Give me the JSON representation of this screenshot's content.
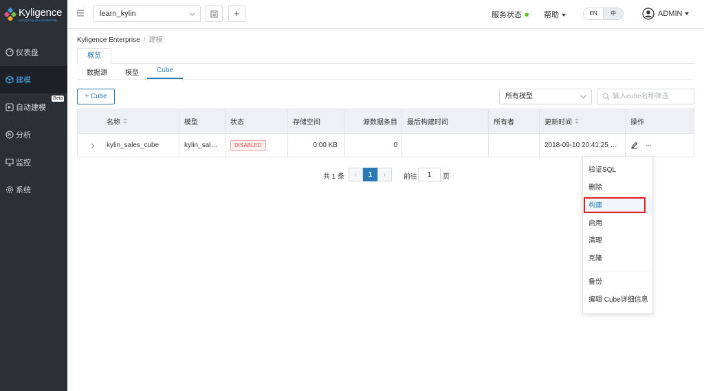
{
  "brand": {
    "name": "Kyligence",
    "tagline": "present big data productivity"
  },
  "sidebar": {
    "items": [
      {
        "label": "仪表盘",
        "icon": "dashboard-icon"
      },
      {
        "label": "建模",
        "icon": "cube-icon"
      },
      {
        "label": "自动建模",
        "icon": "auto-model-icon"
      },
      {
        "label": "分析",
        "icon": "analysis-icon"
      },
      {
        "label": "监控",
        "icon": "monitor-icon"
      },
      {
        "label": "系统",
        "icon": "gear-icon"
      }
    ],
    "beta_badge": "Beta",
    "active_color": "#4ba7e8"
  },
  "topbar": {
    "project": "learn_kylin",
    "add_label": "+",
    "service_status": "服务状态",
    "help": "帮助",
    "lang_en": "EN",
    "lang_zh": "中",
    "user": "ADMIN"
  },
  "breadcrumb": {
    "root": "Kyligence Enterprise",
    "sep": "/",
    "current": "建模"
  },
  "tabs": {
    "overview": "概览"
  },
  "subtabs": [
    "数据源",
    "模型",
    "Cube"
  ],
  "toolbar": {
    "add_cube": "+ Cube",
    "model_filter": "所有模型",
    "search_placeholder": "输入cube名称筛选"
  },
  "table": {
    "headers": {
      "name": "名称",
      "model": "模型",
      "status": "状态",
      "storage": "存储空间",
      "source_records": "源数据条目",
      "last_build": "最后构建时间",
      "owner": "所有者",
      "updated": "更新时间",
      "actions": "操作"
    },
    "rows": [
      {
        "name": "kylin_sales_cube",
        "model": "kylin_sal…",
        "status": "DISABLED",
        "storage": "0.00 KB",
        "source_records": "0",
        "last_build": "",
        "owner": "",
        "updated": "2018-09-10 20:41:25 …",
        "more": "···"
      }
    ]
  },
  "pagination": {
    "total": "共 1 条",
    "prev": "‹",
    "current_page": "1",
    "next": "›",
    "goto_label": "前往",
    "goto_value": "1",
    "goto_unit": "页"
  },
  "menu": {
    "items": [
      "验证SQL",
      "删除",
      "构建",
      "启用",
      "清理",
      "克隆",
      "备份",
      "编辑 Cube详细信息"
    ],
    "highlighted": "构建"
  },
  "colors": {
    "primary": "#2a7ab8",
    "sidebar_bg": "#2b3037",
    "highlight_box": "#e02020",
    "danger": "#e85454"
  }
}
